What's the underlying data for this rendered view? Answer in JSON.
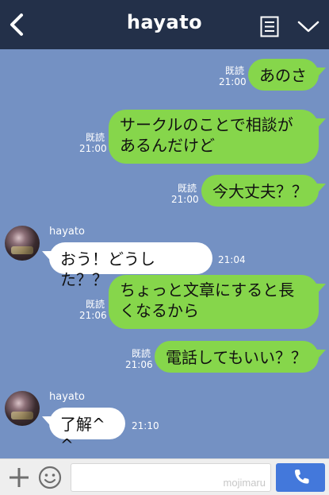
{
  "header": {
    "title": "hayato"
  },
  "messages": [
    {
      "side": "right",
      "text": "あのさ",
      "read": "既読",
      "time": "21:00"
    },
    {
      "side": "right",
      "text": "サークルのことで相談があるんだけど",
      "read": "既読",
      "time": "21:00"
    },
    {
      "side": "right",
      "text": "今大丈夫？？",
      "read": "既読",
      "time": "21:00"
    },
    {
      "side": "left",
      "sender": "hayato",
      "text": "おう！どうした？？",
      "time": "21:04"
    },
    {
      "side": "right",
      "text": "ちょっと文章にすると長くなるから",
      "read": "既読",
      "time": "21:06"
    },
    {
      "side": "right",
      "text": "電話してもいい？？",
      "read": "既読",
      "time": "21:06"
    },
    {
      "side": "left",
      "sender": "hayato",
      "text": "了解^ ^",
      "time": "21:10"
    }
  ],
  "footer": {
    "watermark": "mojimaru"
  },
  "colors": {
    "header_bg": "#233049",
    "chat_bg": "#7491c3",
    "bubble_right": "#86d64b",
    "bubble_left": "#ffffff",
    "call_button": "#4378db"
  }
}
